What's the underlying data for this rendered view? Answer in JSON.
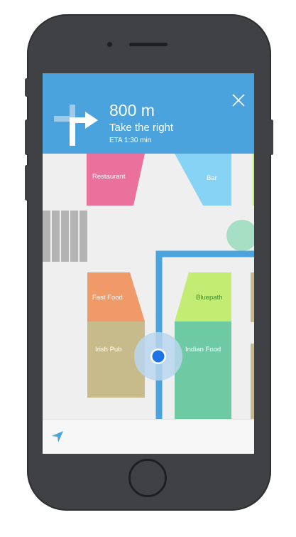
{
  "navigation": {
    "distance": "800 m",
    "instruction": "Take the right",
    "eta": "ETA 1:30 min"
  },
  "map": {
    "places": {
      "restaurant": "Restaurant",
      "bar": "Bar",
      "fast_food": "Fast Food",
      "bluepath": "Bluepath",
      "irish_pub": "Irish Pub",
      "indian_food": "Indian Food"
    }
  },
  "colors": {
    "header": "#4aa3dc",
    "route": "#4aa3dc",
    "restaurant": "#e9719b",
    "bar": "#86d3f6",
    "fast_food": "#ef9a68",
    "bluepath": "#c3ec73",
    "irish_pub": "#c8bb8b",
    "indian_food": "#6dcaa3"
  },
  "icons": {
    "turn": "turn-right-arrow-icon",
    "close": "close-icon",
    "locate": "location-arrow-icon"
  }
}
